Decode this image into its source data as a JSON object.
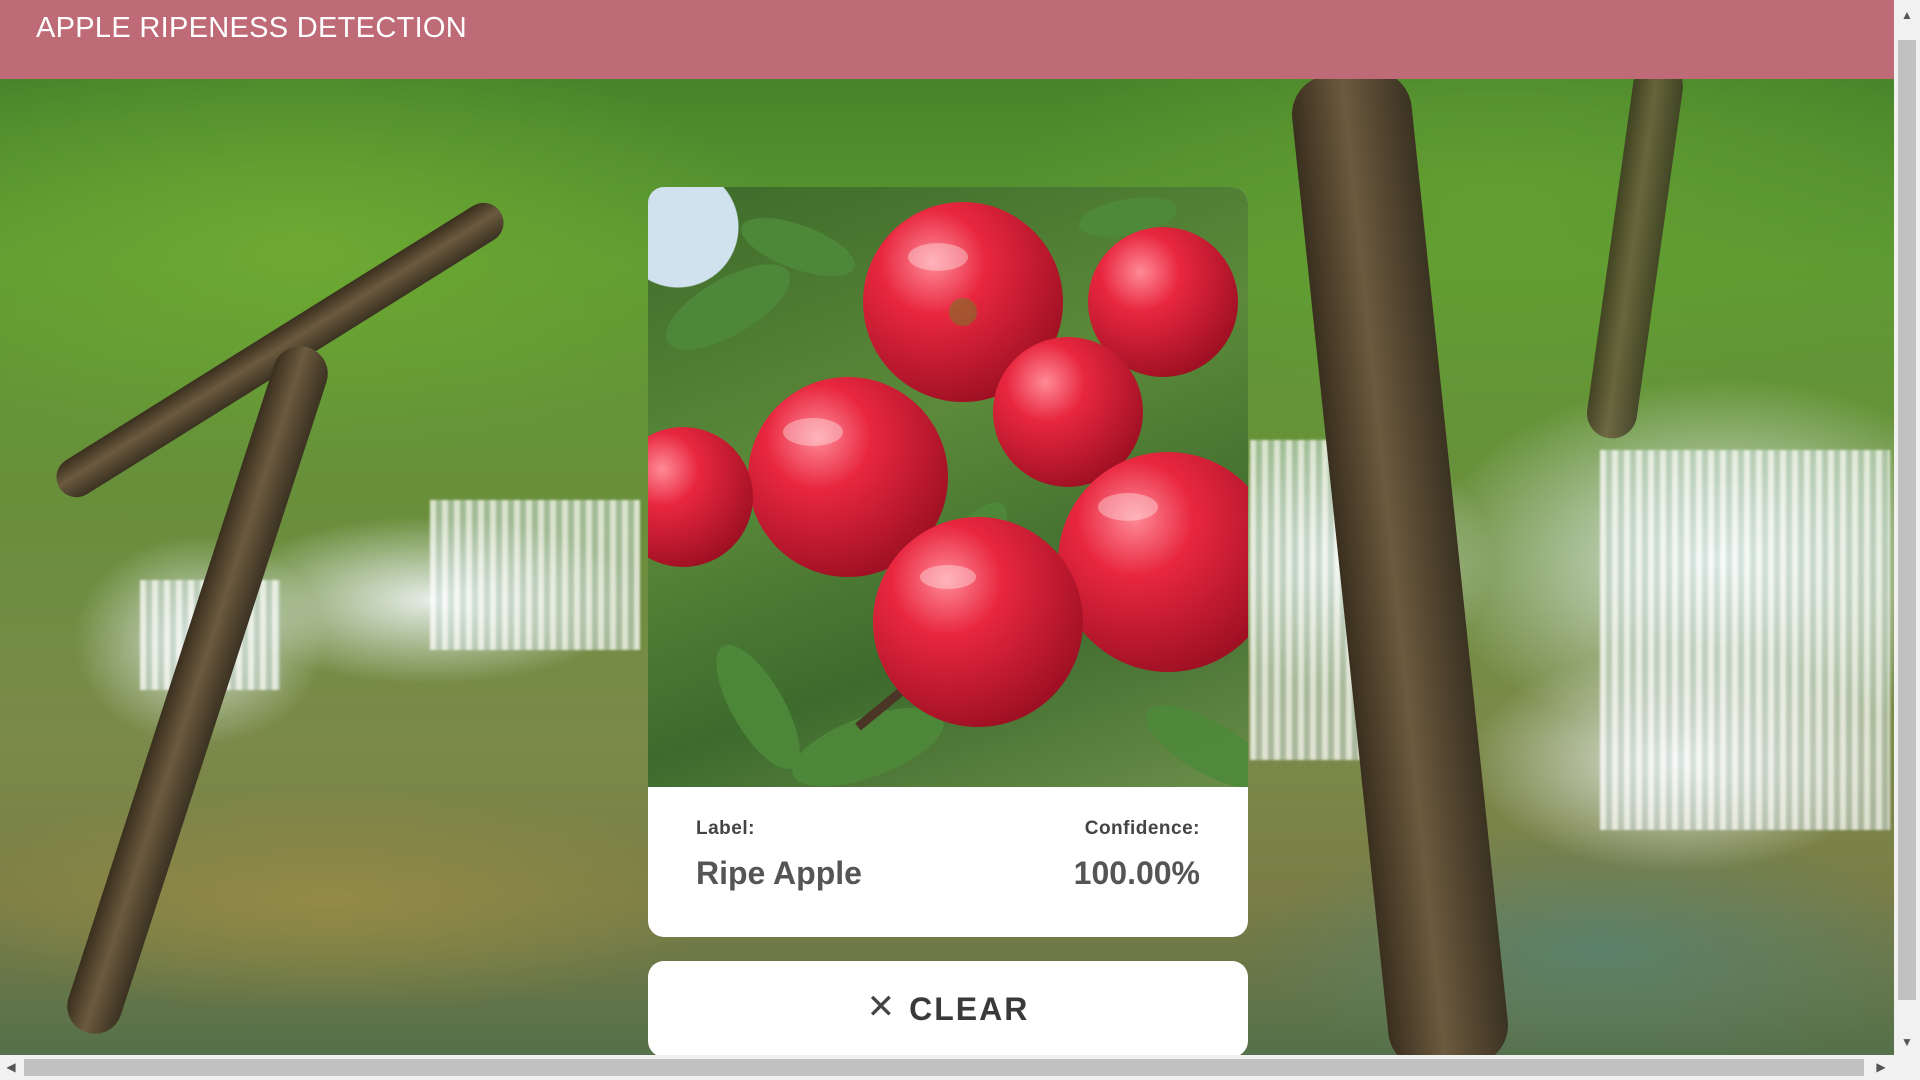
{
  "header": {
    "title": "APPLE RIPENESS DETECTION",
    "background_color": "#bf6b77"
  },
  "result": {
    "image_subject": "red-apples-photo",
    "label_caption": "Label:",
    "label_value": "Ripe Apple",
    "confidence_caption": "Confidence:",
    "confidence_value": "100.00%"
  },
  "actions": {
    "clear_icon": "close-icon",
    "clear_glyph": "✕",
    "clear_label": "CLEAR"
  },
  "scrollbars": {
    "up_arrow": "▲",
    "down_arrow": "▼",
    "left_arrow": "◀",
    "right_arrow": "▶"
  },
  "background": {
    "subject": "forest-waterfall-scene"
  }
}
